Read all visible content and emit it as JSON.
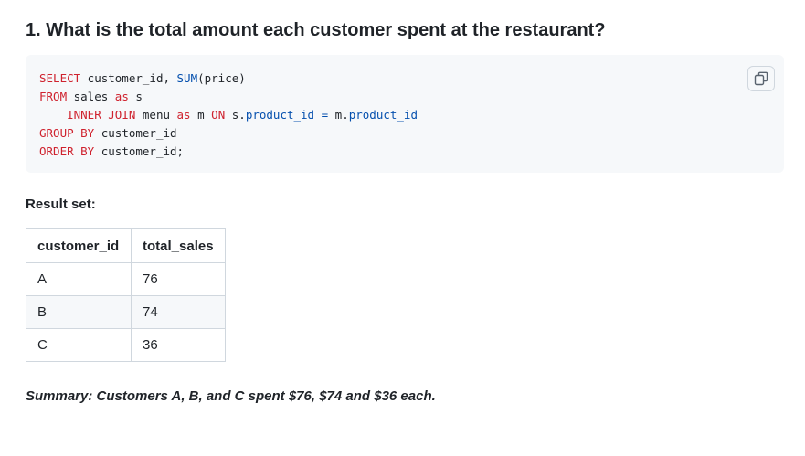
{
  "question": {
    "title": "1. What is the total amount each customer spent at the restaurant?"
  },
  "code": {
    "lines": [
      "SELECT customer_id, SUM(price)",
      "FROM sales as s",
      "    INNER JOIN menu as m ON s.product_id = m.product_id",
      "GROUP BY customer_id",
      "ORDER BY customer_id;"
    ],
    "copy_icon": "copy-icon"
  },
  "result": {
    "label": "Result set:",
    "headers": [
      "customer_id",
      "total_sales"
    ],
    "rows": [
      [
        "A",
        "76"
      ],
      [
        "B",
        "74"
      ],
      [
        "C",
        "36"
      ]
    ]
  },
  "summary": "Summary: Customers A, B, and C spent $76, $74 and $36 each.",
  "colors": {
    "keyword": "#cf222e",
    "function": "#0550ae",
    "code_background": "#f6f8fa",
    "border": "#d0d7de"
  }
}
